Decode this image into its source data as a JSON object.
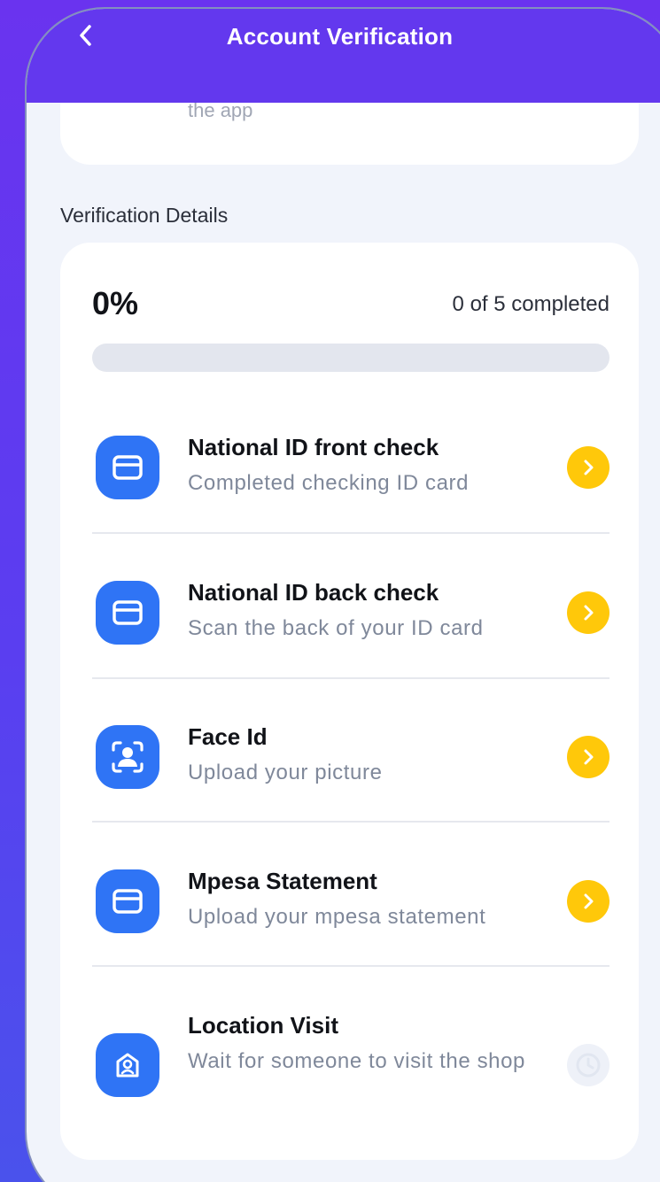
{
  "header": {
    "title": "Account Verification",
    "back_icon": "chevron-left-icon"
  },
  "top_card": {
    "partial_text": "the app"
  },
  "section": {
    "label": "Verification Details"
  },
  "progress": {
    "percent_label": "0%",
    "completed_label": "0 of 5 completed",
    "fraction": 0
  },
  "steps": [
    {
      "title": "National ID front check",
      "subtitle": "Completed checking ID card",
      "icon": "id-card-icon",
      "status": "actionable",
      "action_icon": "chevron-right-icon"
    },
    {
      "title": "National ID back check",
      "subtitle": "Scan the back of your ID card",
      "icon": "id-card-icon",
      "status": "actionable",
      "action_icon": "chevron-right-icon"
    },
    {
      "title": "Face Id",
      "subtitle": "Upload your picture",
      "icon": "face-scan-icon",
      "status": "actionable",
      "action_icon": "chevron-right-icon"
    },
    {
      "title": "Mpesa Statement",
      "subtitle": "Upload your mpesa statement",
      "icon": "id-card-icon",
      "status": "actionable",
      "action_icon": "chevron-right-icon"
    },
    {
      "title": "Location Visit",
      "subtitle": "Wait for someone to visit the shop",
      "icon": "shop-location-icon",
      "status": "pending",
      "action_icon": "clock-icon"
    }
  ],
  "colors": {
    "header": "#6338ee",
    "accent_blue": "#2f74f5",
    "chevron_yellow": "#ffc80a",
    "background": "#f1f4fb"
  }
}
